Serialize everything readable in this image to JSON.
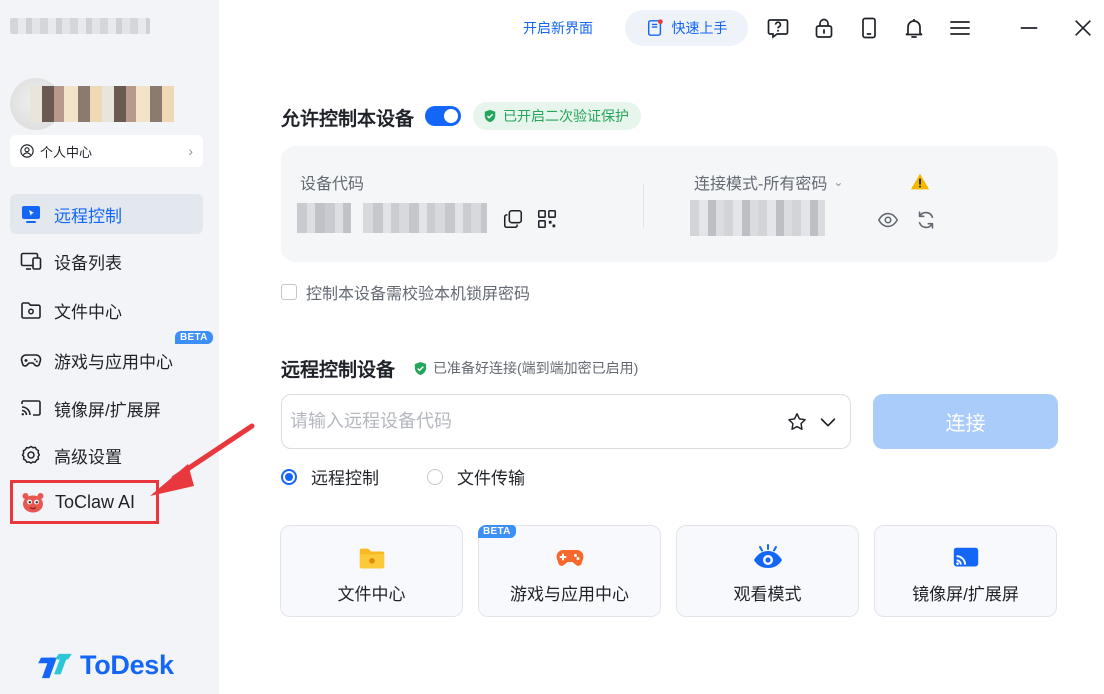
{
  "sidebar": {
    "personal_center": "个人中心",
    "items": [
      {
        "label": "远程控制",
        "icon": "remote-control-icon",
        "active": true
      },
      {
        "label": "设备列表",
        "icon": "device-list-icon"
      },
      {
        "label": "文件中心",
        "icon": "folder-icon"
      },
      {
        "label": "游戏与应用中心",
        "icon": "gamepad-icon",
        "badge": "BETA"
      },
      {
        "label": "镜像屏/扩展屏",
        "icon": "cast-screen-icon"
      },
      {
        "label": "高级设置",
        "icon": "gear-icon"
      }
    ],
    "toclaw": "ToClaw AI",
    "logo": "ToDesk"
  },
  "topbar": {
    "new_ui": "开启新界面",
    "quick_start": "快速上手"
  },
  "allow_control": {
    "title": "允许控制本设备",
    "enabled": true,
    "verify_badge": "已开启二次验证保护",
    "device_code_label": "设备代码",
    "connection_mode": "连接模式-所有密码",
    "lock_screen_check": "控制本设备需校验本机锁屏密码"
  },
  "remote_control": {
    "title": "远程控制设备",
    "ready": "已准备好连接(端到端加密已启用)",
    "input_placeholder": "请输入远程设备代码",
    "connect": "连接",
    "mode_remote": "远程控制",
    "mode_file": "文件传输",
    "features": [
      {
        "label": "文件中心",
        "icon": "folder-icon"
      },
      {
        "label": "游戏与应用中心",
        "icon": "gamepad-icon",
        "badge": "BETA"
      },
      {
        "label": "观看模式",
        "icon": "eye-icon"
      },
      {
        "label": "镜像屏/扩展屏",
        "icon": "cast-screen-icon"
      }
    ]
  },
  "colors": {
    "accent": "#1466f6",
    "success": "#23a55a",
    "highlight": "#e8383d",
    "warning": "#f5b800"
  }
}
